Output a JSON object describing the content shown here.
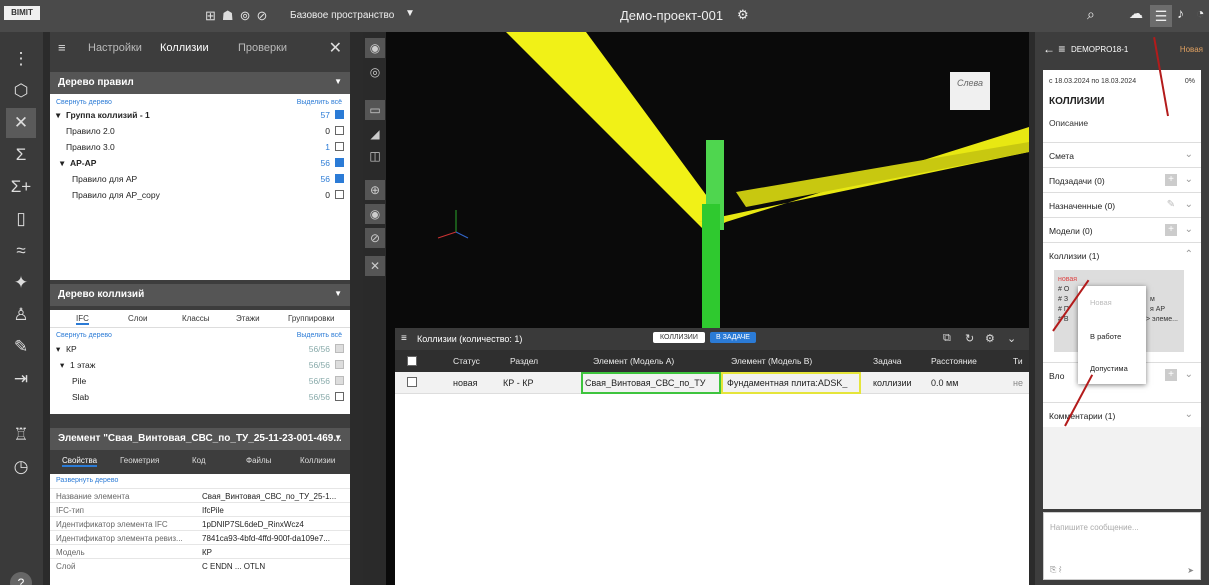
{
  "app": {
    "logo": "BIMIT",
    "space": "Базовое пространство",
    "project": "Демо-проект-001"
  },
  "left_panel": {
    "tabs": [
      "Настройки",
      "Коллизии",
      "Проверки"
    ],
    "rules": {
      "title": "Дерево правил",
      "collapse": "Свернуть дерево",
      "select_all": "Выделить всё",
      "rows": [
        {
          "label": "Группа коллизий - 1",
          "count": "57"
        },
        {
          "label": "Правило 2.0",
          "count": "0"
        },
        {
          "label": "Правило 3.0",
          "count": "1"
        },
        {
          "label": "AP-AP",
          "count": "56"
        },
        {
          "label": "Правило для AP",
          "count": "56"
        },
        {
          "label": "Правило для AP_copy",
          "count": "0"
        }
      ]
    },
    "collisions_tree": {
      "title": "Дерево коллизий",
      "tabs": [
        "IFC",
        "Слои",
        "Классы",
        "Этажи",
        "Группировки"
      ],
      "collapse": "Свернуть дерево",
      "select_all": "Выделить всё",
      "rows": [
        {
          "label": "КР",
          "count": "56/56"
        },
        {
          "label": "1 этаж",
          "count": "56/56"
        },
        {
          "label": "Pile",
          "count": "56/56"
        },
        {
          "label": "Slab",
          "count": "56/56"
        }
      ]
    },
    "element": {
      "title": "Элемент \"Свая_Винтовая_СВС_по_ТУ_25-11-23-001-469...",
      "tabs": [
        "Свойства",
        "Геометрия",
        "Код",
        "Файлы",
        "Коллизии"
      ],
      "expand": "Развернуть дерево",
      "props": [
        {
          "k": "Название элемента",
          "v": "Свая_Винтовая_СВС_по_ТУ_25-1..."
        },
        {
          "k": "IFC-тип",
          "v": "IfcPile"
        },
        {
          "k": "Идентификатор элемента IFC",
          "v": "1pDNIP7SL6deD_RinxWcz4"
        },
        {
          "k": "Идентификатор элемента ревиз...",
          "v": "7841ca93-4bfd-4ffd-900f-da109e7..."
        },
        {
          "k": "Модель",
          "v": "КР"
        },
        {
          "k": "Слой",
          "v": "С ENDN ... OTLN"
        }
      ]
    }
  },
  "viewport": {
    "cube_label": "Слева"
  },
  "collisions_panel": {
    "title": "Коллизии (количество: 1)",
    "btn_collisions": "КОЛЛИЗИИ",
    "btn_task": "В ЗАДАЧЕ",
    "columns": [
      "Статус",
      "Раздел",
      "Элемент (Модель А)",
      "Элемент (Модель В)",
      "Задача",
      "Расстояние",
      "Ти"
    ],
    "row": {
      "status": "новая",
      "section": "КР - КР",
      "a": "Свая_Винтовая_СВС_по_ТУ",
      "b": "Фундаментная плита:ADSK_",
      "task": "коллизии",
      "dist": "0.0 мм",
      "type": "не"
    }
  },
  "right_panel": {
    "code": "DEMOPRO18-1",
    "badge": "Новая",
    "date": "с 18.03.2024 по 18.03.2024",
    "pct": "0%",
    "title": "КОЛЛИЗИИ",
    "desc": "Описание",
    "sections": [
      "Смета",
      "Подзадачи (0)",
      "Назначенные (0)",
      "Модели (0)",
      "Коллизии (1)"
    ],
    "collision_card": [
      "новая",
      "# О",
      "# З",
      "# П",
      "# В",
      "м",
      "я АР",
      "> элеме..."
    ],
    "popup": [
      "Новая",
      "В работе",
      "Допустима"
    ],
    "more": "Вло",
    "comments": "Комментарии (1)",
    "msg_placeholder": "Напишите сообщение..."
  }
}
